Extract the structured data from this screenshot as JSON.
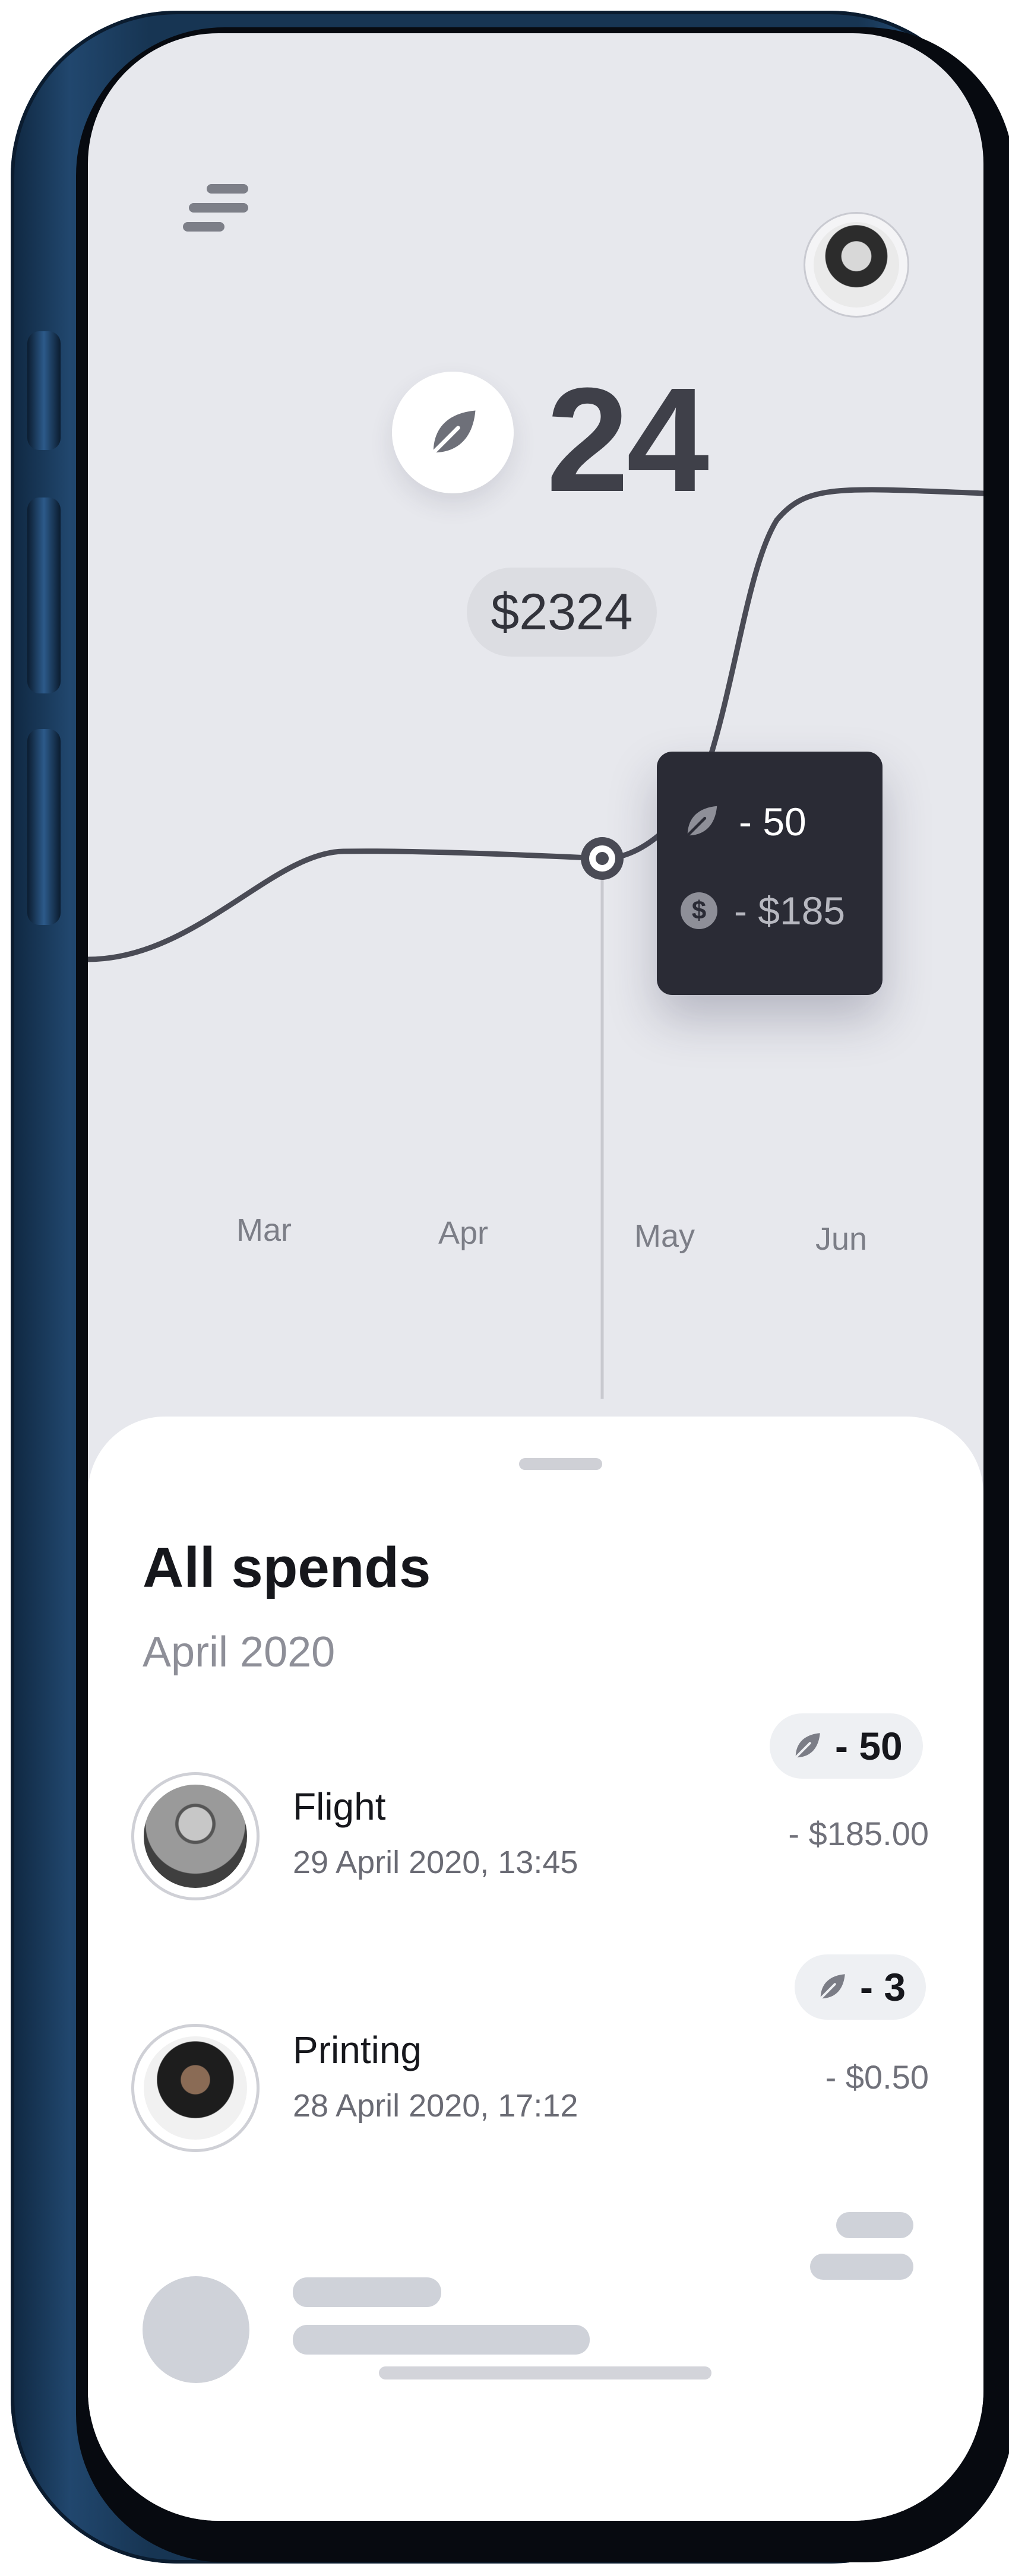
{
  "header": {
    "leaf_count": "24",
    "balance": "$2324"
  },
  "tooltip": {
    "leaf_delta": "- 50",
    "money_delta": "- $185",
    "dollar_glyph": "$"
  },
  "chart_data": {
    "type": "line",
    "categories": [
      "Mar",
      "Apr",
      "May",
      "Jun"
    ],
    "highlighted_category": "May"
  },
  "sheet": {
    "title": "All spends",
    "subtitle": "April 2020",
    "items": [
      {
        "name": "Flight",
        "date": "29 April 2020, 13:45",
        "leaf_badge": "- 50",
        "amount": "- $185.00"
      },
      {
        "name": "Printing",
        "date": "28 April 2020, 17:12",
        "leaf_badge": "- 3",
        "amount": "- $0.50"
      }
    ]
  },
  "colors": {
    "accent_dark": "#2a2b35",
    "background": "#e7e8ed",
    "text_dark": "#16171c"
  },
  "icons": [
    "menu-icon",
    "leaf-icon",
    "dollar-icon",
    "profile-avatar"
  ]
}
